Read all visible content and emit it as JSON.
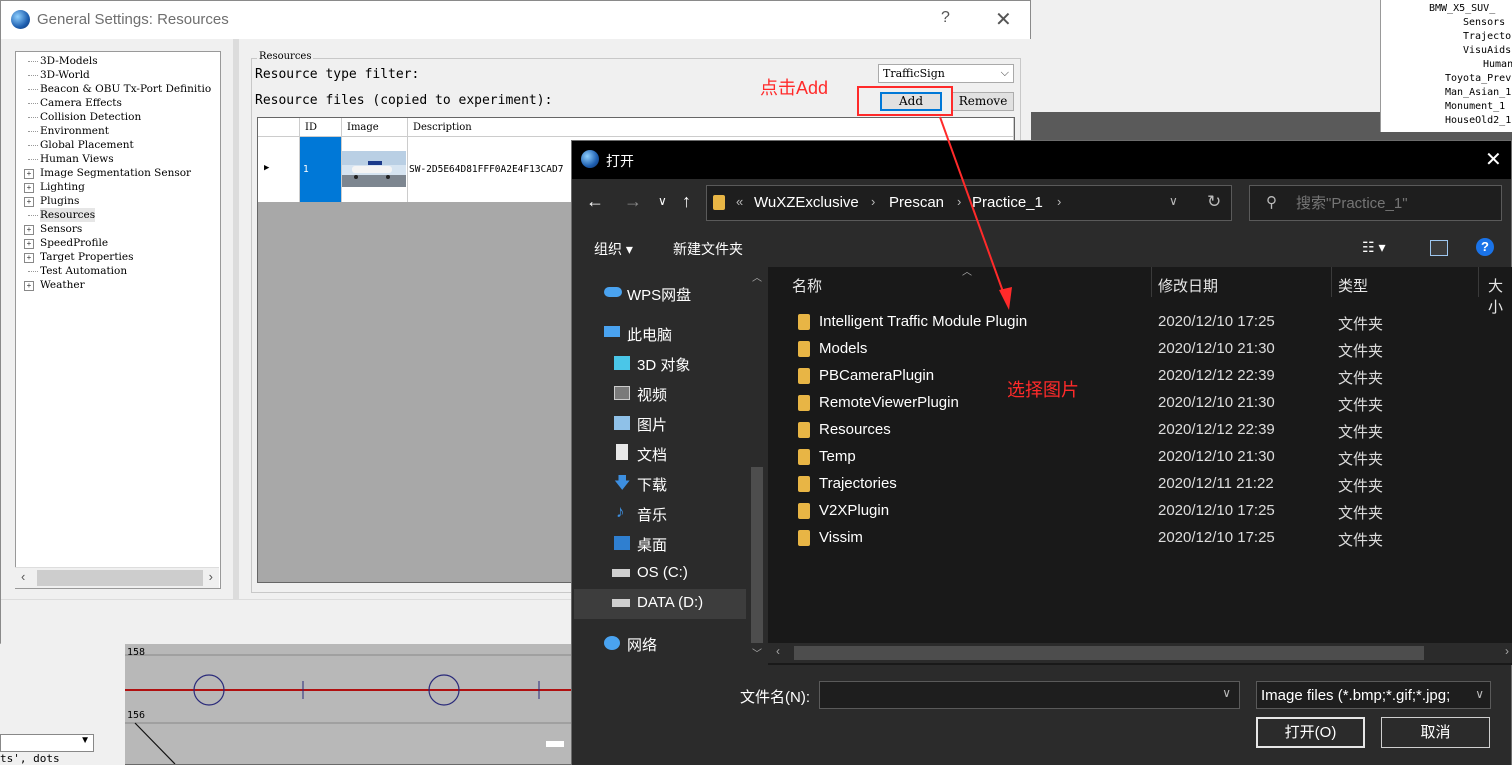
{
  "background": {
    "tree_items": [
      "BMW_X5_SUV_",
      "Sensors",
      "Trajecto",
      "VisuAids",
      "Human",
      "Toyota_Prev",
      "Man_Asian_1",
      "Monument_1",
      "HouseOld2_1"
    ],
    "chart_labels": [
      "158",
      "156"
    ],
    "left_text": "ts', dots"
  },
  "general_settings": {
    "title": "General Settings: Resources",
    "help": "?",
    "close": "✕",
    "tree": [
      {
        "label": "3D-Models",
        "expandable": false
      },
      {
        "label": "3D-World",
        "expandable": false
      },
      {
        "label": "Beacon & OBU Tx-Port Definitio",
        "expandable": false
      },
      {
        "label": "Camera Effects",
        "expandable": false
      },
      {
        "label": "Collision Detection",
        "expandable": false
      },
      {
        "label": "Environment",
        "expandable": false
      },
      {
        "label": "Global Placement",
        "expandable": false
      },
      {
        "label": "Human Views",
        "expandable": false
      },
      {
        "label": "Image Segmentation Sensor",
        "expandable": true
      },
      {
        "label": "Lighting",
        "expandable": true
      },
      {
        "label": "Plugins",
        "expandable": true
      },
      {
        "label": "Resources",
        "expandable": false,
        "selected": true
      },
      {
        "label": "Sensors",
        "expandable": true
      },
      {
        "label": "SpeedProfile",
        "expandable": true
      },
      {
        "label": "Target Properties",
        "expandable": true
      },
      {
        "label": "Test Automation",
        "expandable": false
      },
      {
        "label": "Weather",
        "expandable": true
      }
    ],
    "group_title": "Resources",
    "filter_label": "Resource type filter:",
    "filter_value": "TrafficSign",
    "files_label": "Resource files (copied to experiment):",
    "add_label": "Add",
    "remove_label": "Remove",
    "columns": [
      "ID",
      "Image",
      "Description"
    ],
    "rows": [
      {
        "id": "1",
        "description": "SW-2D5E64D81FFF0A2E4F13CAD7"
      }
    ]
  },
  "annotations": {
    "click_add": "点击Add",
    "select_image": "选择图片",
    "color": "#ff2a2a"
  },
  "open_dialog": {
    "title": "打开",
    "close": "✕",
    "breadcrumb": [
      "«",
      "WuXZExclusive",
      "Prescan",
      "Practice_1"
    ],
    "search_placeholder": "搜索\"Practice_1\"",
    "organize": "组织 ▾",
    "new_folder": "新建文件夹",
    "nav": [
      {
        "label": "WPS网盘",
        "icon": "cloud-icon"
      },
      {
        "label": "此电脑",
        "icon": "computer-icon"
      },
      {
        "label": "3D 对象",
        "icon": "cube-icon"
      },
      {
        "label": "视频",
        "icon": "video-icon"
      },
      {
        "label": "图片",
        "icon": "picture-icon"
      },
      {
        "label": "文档",
        "icon": "document-icon"
      },
      {
        "label": "下载",
        "icon": "download-icon"
      },
      {
        "label": "音乐",
        "icon": "music-icon"
      },
      {
        "label": "桌面",
        "icon": "desktop-icon"
      },
      {
        "label": "OS (C:)",
        "icon": "drive-icon"
      },
      {
        "label": "DATA (D:)",
        "icon": "drive-icon",
        "selected": true
      },
      {
        "label": "网络",
        "icon": "network-icon"
      }
    ],
    "columns": {
      "name": "名称",
      "date": "修改日期",
      "type": "类型",
      "size": "大小"
    },
    "files": [
      {
        "name": "Intelligent Traffic Module Plugin",
        "date": "2020/12/10 17:25",
        "type": "文件夹"
      },
      {
        "name": "Models",
        "date": "2020/12/10 21:30",
        "type": "文件夹"
      },
      {
        "name": "PBCameraPlugin",
        "date": "2020/12/12 22:39",
        "type": "文件夹"
      },
      {
        "name": "RemoteViewerPlugin",
        "date": "2020/12/10 21:30",
        "type": "文件夹"
      },
      {
        "name": "Resources",
        "date": "2020/12/12 22:39",
        "type": "文件夹"
      },
      {
        "name": "Temp",
        "date": "2020/12/10 21:30",
        "type": "文件夹"
      },
      {
        "name": "Trajectories",
        "date": "2020/12/11 21:22",
        "type": "文件夹"
      },
      {
        "name": "V2XPlugin",
        "date": "2020/12/10 17:25",
        "type": "文件夹"
      },
      {
        "name": "Vissim",
        "date": "2020/12/10 17:25",
        "type": "文件夹"
      }
    ],
    "filename_label": "文件名(N):",
    "filename_value": "",
    "filetype_value": "Image files (*.bmp;*.gif;*.jpg;",
    "open_label": "打开(O)",
    "cancel_label": "取消"
  }
}
